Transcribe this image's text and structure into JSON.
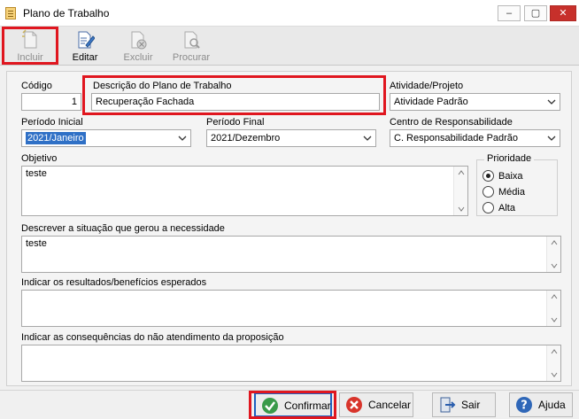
{
  "window": {
    "title": "Plano de Trabalho",
    "controls": {
      "minimize": "–",
      "maximize": "▢",
      "close": "✕"
    }
  },
  "toolbar": {
    "incluir": "Incluir",
    "editar": "Editar",
    "excluir": "Excluir",
    "procurar": "Procurar"
  },
  "form": {
    "codigo": {
      "label": "Código",
      "value": "1"
    },
    "descricao": {
      "label": "Descrição do Plano de Trabalho",
      "value": "Recuperação Fachada"
    },
    "atividade": {
      "label": "Atividade/Projeto",
      "value": "Atividade Padrão"
    },
    "periodo_inicial": {
      "label": "Período Inicial",
      "value": "2021/Janeiro"
    },
    "periodo_final": {
      "label": "Período Final",
      "value": "2021/Dezembro"
    },
    "centro": {
      "label": "Centro de Responsabilidade",
      "value": "C. Responsabilidade Padrão"
    },
    "objetivo": {
      "label": "Objetivo",
      "value": "teste"
    },
    "prioridade": {
      "title": "Prioridade",
      "options": [
        "Baixa",
        "Média",
        "Alta"
      ],
      "selected": "Baixa"
    },
    "situacao": {
      "label": "Descrever a situação que gerou a necessidade",
      "value": "teste"
    },
    "resultados": {
      "label": "Indicar os resultados/benefícios esperados",
      "value": ""
    },
    "consequencias": {
      "label": "Indicar as consequências do não atendimento da proposição",
      "value": ""
    }
  },
  "footer": {
    "confirmar": "Confirmar",
    "cancelar": "Cancelar",
    "sair": "Sair",
    "ajuda": "Ajuda"
  },
  "colors": {
    "highlight": "#e0161f",
    "selection": "#2f70c6",
    "close": "#c7302b"
  }
}
